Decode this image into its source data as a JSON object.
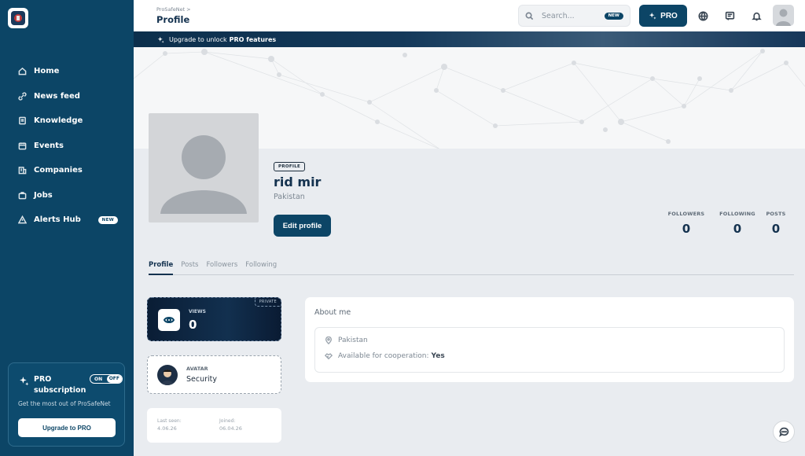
{
  "sidebar": {
    "items": [
      {
        "label": "Home",
        "icon": "home-icon"
      },
      {
        "label": "News feed",
        "icon": "link-icon"
      },
      {
        "label": "Knowledge",
        "icon": "book-icon"
      },
      {
        "label": "Events",
        "icon": "calendar-icon"
      },
      {
        "label": "Companies",
        "icon": "building-icon"
      },
      {
        "label": "Jobs",
        "icon": "briefcase-icon"
      },
      {
        "label": "Alerts Hub",
        "icon": "warning-icon",
        "badge": "NEW"
      }
    ],
    "pro_card": {
      "title": "PRO subscription",
      "toggle_on": "ON",
      "toggle_off": "OFF",
      "description": "Get the most out of ProSafeNet",
      "button": "Upgrade to PRO"
    }
  },
  "header": {
    "breadcrumb": "ProSafeNet >",
    "title": "Profile",
    "search_placeholder": "Search...",
    "search_badge": "NEW",
    "pro_button": "PRO"
  },
  "banner": {
    "text": "Upgrade to unlock",
    "bold": "PRO features"
  },
  "profile": {
    "tag": "PROFILE",
    "name": "rid mir",
    "country": "Pakistan",
    "edit_button": "Edit profile",
    "stats": [
      {
        "label": "FOLLOWERS",
        "value": "0"
      },
      {
        "label": "FOLLOWING",
        "value": "0"
      },
      {
        "label": "POSTS",
        "value": "0"
      }
    ]
  },
  "tabs": [
    "Profile",
    "Posts",
    "Followers",
    "Following"
  ],
  "views_card": {
    "label": "VIEWS",
    "value": "0",
    "badge": "PRIVATE"
  },
  "avatar_card": {
    "label": "AVATAR",
    "value": "Security"
  },
  "dates_card": {
    "last_seen_label": "Last seen:",
    "last_seen_value": "4.06.26",
    "joined_label": "Joined:",
    "joined_value": "06.04.26"
  },
  "about": {
    "title": "About me",
    "location": "Pakistan",
    "cooperation_label": "Available for cooperation:",
    "cooperation_value": "Yes"
  },
  "colors": {
    "primary": "#0c4566",
    "background": "#e9ecf0",
    "text": "#14324f"
  }
}
